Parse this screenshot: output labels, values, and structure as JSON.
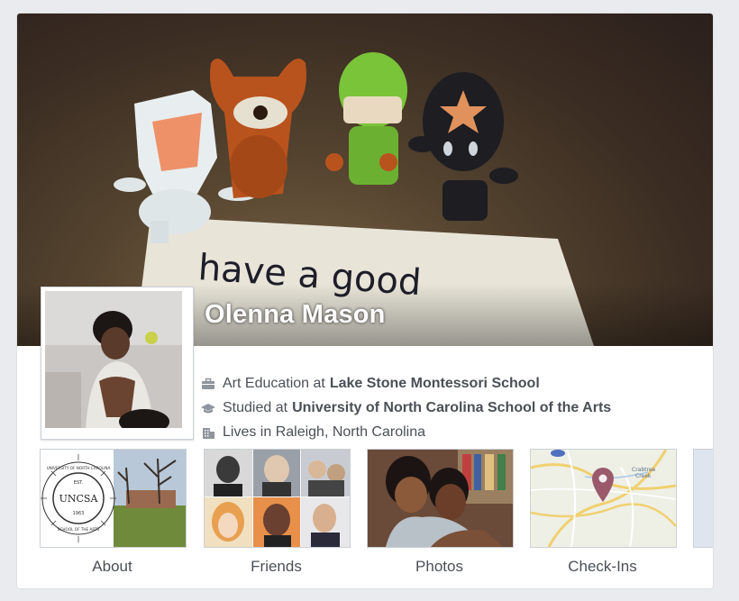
{
  "profile": {
    "name": "Olenna Mason",
    "cover_note_text": "have a good",
    "work_prefix": "Art Education at",
    "work_place": "Lake Stone Montessori School",
    "education_prefix": "Studied at",
    "education_place": "University of North Carolina School of the Arts",
    "lives_text": "Lives in Raleigh, North Carolina"
  },
  "tiles": [
    {
      "label": "About",
      "icon": "about-tile"
    },
    {
      "label": "Friends",
      "icon": "friends-tile"
    },
    {
      "label": "Photos",
      "icon": "photos-tile"
    },
    {
      "label": "Check-Ins",
      "icon": "map-tile"
    }
  ],
  "seal": {
    "text": "UNCSA",
    "est": "EST.",
    "year": "1963",
    "ring_top": "UNIVERSITY OF NORTH CAROLINA",
    "ring_bottom": "SCHOOL OF THE ARTS"
  },
  "map": {
    "label": "Crabtree Creek",
    "label_line1": "Crabtree",
    "label_line2": "Creek",
    "pin_color": "#9b5a6c"
  },
  "colors": {
    "background": "#e9ebee",
    "text": "#4b4f56",
    "name_text": "#ffffff"
  }
}
